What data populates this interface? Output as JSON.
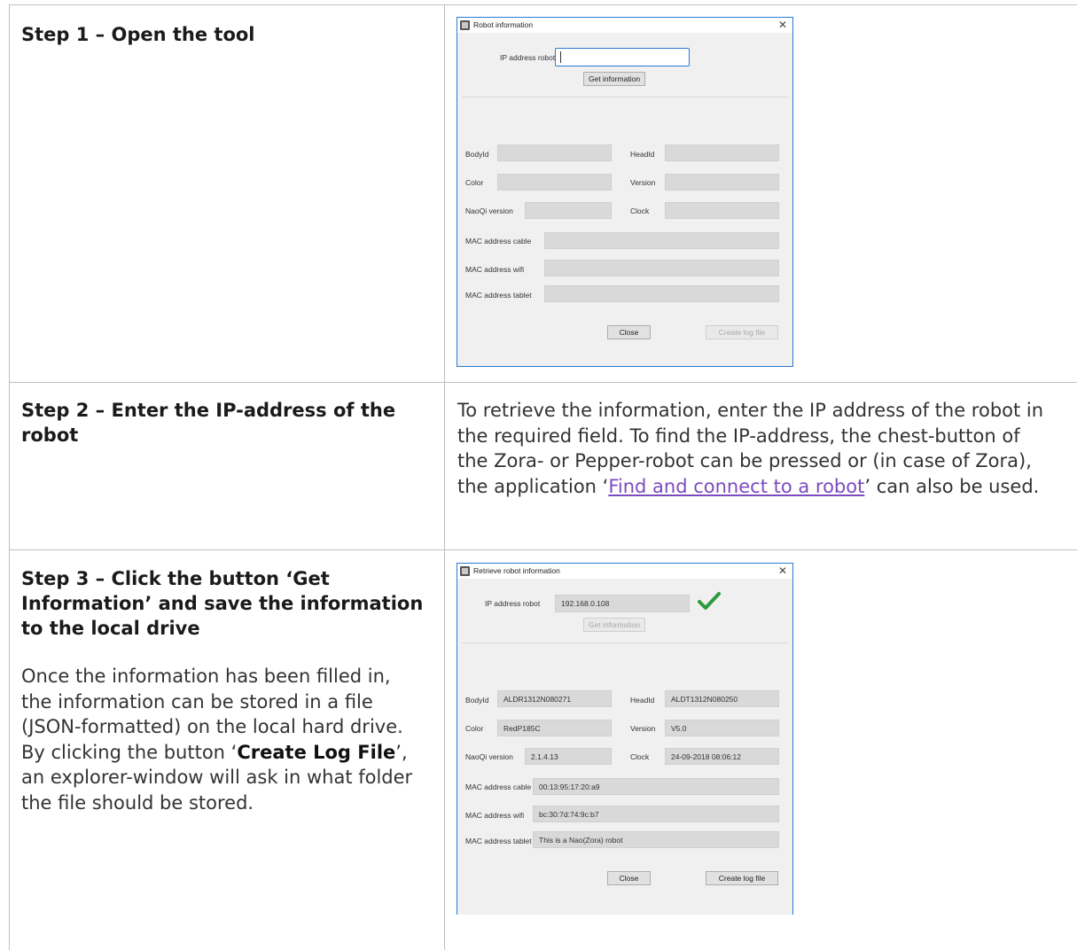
{
  "step1": {
    "title": "Step 1 – Open the tool",
    "dialog": {
      "title": "Robot information",
      "close_glyph": "✕",
      "ip_label": "IP address robot",
      "ip_value": "",
      "get_info_label": "Get information",
      "fields": {
        "bodyid_label": "BodyId",
        "bodyid_value": "",
        "headid_label": "HeadId",
        "headid_value": "",
        "color_label": "Color",
        "color_value": "",
        "version_label": "Version",
        "version_value": "",
        "naoqi_label": "NaoQi version",
        "naoqi_value": "",
        "clock_label": "Clock",
        "clock_value": "",
        "mac_cable_label": "MAC address cable",
        "mac_cable_value": "",
        "mac_wifi_label": "MAC address wifi",
        "mac_wifi_value": "",
        "mac_tablet_label": "MAC address tablet",
        "mac_tablet_value": ""
      },
      "close_label": "Close",
      "create_log_label": "Create log file"
    }
  },
  "step2": {
    "title": "Step 2 – Enter the IP-address of the robot",
    "text_before_link": "To retrieve the information, enter the IP address of the robot in the required field. To find the IP-address, the chest-button of the Zora- or Pepper-robot can be pressed or (in case of Zora), the application ‘",
    "link_text": "Find and connect to a robot",
    "text_after_link": "’ can also be used."
  },
  "step3": {
    "title": "Step 3 – Click the button ‘Get Information’ and save the information to the local drive",
    "text_part1": "Once the information has been filled in, the information can be stored in a file (JSON-formatted) on the local hard drive. By clicking the button ‘",
    "text_bold": "Create Log File",
    "text_part2": "’, an explorer-window will ask in what folder the file should be stored.",
    "dialog": {
      "title": "Retrieve robot information",
      "close_glyph": "✕",
      "ip_label": "IP address robot",
      "ip_value": "192.168.0.108",
      "check_icon": "green-checkmark-icon",
      "get_info_label": "Get information",
      "fields": {
        "bodyid_label": "BodyId",
        "bodyid_value": "ALDR1312N080271",
        "headid_label": "HeadId",
        "headid_value": "ALDT1312N080250",
        "color_label": "Color",
        "color_value": "RedP185C",
        "version_label": "Version",
        "version_value": "V5.0",
        "naoqi_label": "NaoQi version",
        "naoqi_value": "2.1.4.13",
        "clock_label": "Clock",
        "clock_value": "24-09-2018 08:06:12",
        "mac_cable_label": "MAC address cable",
        "mac_cable_value": "00:13:95:17:20:a9",
        "mac_wifi_label": "MAC address wifi",
        "mac_wifi_value": "bc:30:7d:74:9c:b7",
        "mac_tablet_label": "MAC address tablet",
        "mac_tablet_value": "This is a Nao(Zora) robot"
      },
      "close_label": "Close",
      "create_log_label": "Create log file"
    }
  },
  "colors": {
    "link": "#7b4bbf",
    "check": "#2e9a3c",
    "dialog_border": "#2b79d6"
  }
}
